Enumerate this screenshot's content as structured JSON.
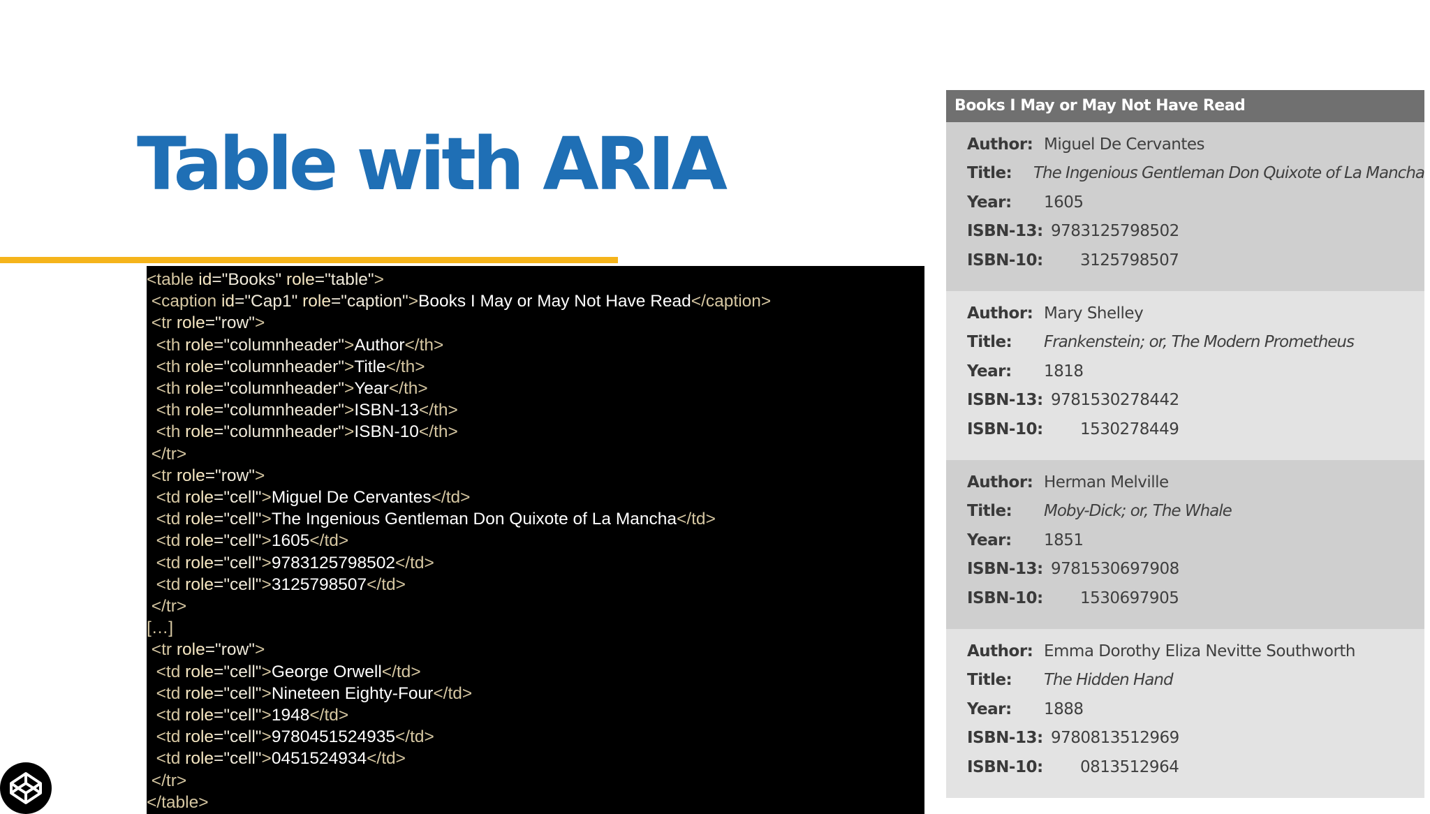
{
  "slide": {
    "title": "Table with ARIA"
  },
  "code": {
    "lines": [
      [
        [
          "tag",
          "<table "
        ],
        [
          "attr",
          "id"
        ],
        [
          "val",
          "=\"Books\" "
        ],
        [
          "attr",
          "role"
        ],
        [
          "val",
          "=\"table\""
        ],
        [
          "tag",
          ">"
        ]
      ],
      [
        [
          "tag",
          " <caption "
        ],
        [
          "attr",
          "id"
        ],
        [
          "val",
          "=\"Cap1\" "
        ],
        [
          "attr",
          "role"
        ],
        [
          "val",
          "=\"caption\""
        ],
        [
          "tag",
          ">"
        ],
        [
          "txt",
          "Books I May or May Not Have Read"
        ],
        [
          "tag",
          "</caption>"
        ]
      ],
      [
        [
          "tag",
          " <tr "
        ],
        [
          "attr",
          "role"
        ],
        [
          "val",
          "=\"row\""
        ],
        [
          "tag",
          ">"
        ]
      ],
      [
        [
          "tag",
          "  <th "
        ],
        [
          "attr",
          "role"
        ],
        [
          "val",
          "=\"columnheader\""
        ],
        [
          "tag",
          ">"
        ],
        [
          "txt",
          "Author"
        ],
        [
          "tag",
          "</th>"
        ]
      ],
      [
        [
          "tag",
          "  <th "
        ],
        [
          "attr",
          "role"
        ],
        [
          "val",
          "=\"columnheader\""
        ],
        [
          "tag",
          ">"
        ],
        [
          "txt",
          "Title"
        ],
        [
          "tag",
          "</th>"
        ]
      ],
      [
        [
          "tag",
          "  <th "
        ],
        [
          "attr",
          "role"
        ],
        [
          "val",
          "=\"columnheader\""
        ],
        [
          "tag",
          ">"
        ],
        [
          "txt",
          "Year"
        ],
        [
          "tag",
          "</th>"
        ]
      ],
      [
        [
          "tag",
          "  <th "
        ],
        [
          "attr",
          "role"
        ],
        [
          "val",
          "=\"columnheader\""
        ],
        [
          "tag",
          ">"
        ],
        [
          "txt",
          "ISBN-13"
        ],
        [
          "tag",
          "</th>"
        ]
      ],
      [
        [
          "tag",
          "  <th "
        ],
        [
          "attr",
          "role"
        ],
        [
          "val",
          "=\"columnheader\""
        ],
        [
          "tag",
          ">"
        ],
        [
          "txt",
          "ISBN-10"
        ],
        [
          "tag",
          "</th>"
        ]
      ],
      [
        [
          "tag",
          " </tr>"
        ]
      ],
      [
        [
          "tag",
          " <tr "
        ],
        [
          "attr",
          "role"
        ],
        [
          "val",
          "=\"row\""
        ],
        [
          "tag",
          ">"
        ]
      ],
      [
        [
          "tag",
          "  <td "
        ],
        [
          "attr",
          "role"
        ],
        [
          "val",
          "=\"cell\""
        ],
        [
          "tag",
          ">"
        ],
        [
          "txt",
          "Miguel De Cervantes"
        ],
        [
          "tag",
          "</td>"
        ]
      ],
      [
        [
          "tag",
          "  <td "
        ],
        [
          "attr",
          "role"
        ],
        [
          "val",
          "=\"cell\""
        ],
        [
          "tag",
          ">"
        ],
        [
          "txt",
          "The Ingenious Gentleman Don Quixote of La Mancha"
        ],
        [
          "tag",
          "</td>"
        ]
      ],
      [
        [
          "tag",
          "  <td "
        ],
        [
          "attr",
          "role"
        ],
        [
          "val",
          "=\"cell\""
        ],
        [
          "tag",
          ">"
        ],
        [
          "txt",
          "1605"
        ],
        [
          "tag",
          "</td>"
        ]
      ],
      [
        [
          "tag",
          "  <td "
        ],
        [
          "attr",
          "role"
        ],
        [
          "val",
          "=\"cell\""
        ],
        [
          "tag",
          ">"
        ],
        [
          "txt",
          "9783125798502"
        ],
        [
          "tag",
          "</td>"
        ]
      ],
      [
        [
          "tag",
          "  <td "
        ],
        [
          "attr",
          "role"
        ],
        [
          "val",
          "=\"cell\""
        ],
        [
          "tag",
          ">"
        ],
        [
          "txt",
          "3125798507"
        ],
        [
          "tag",
          "</td>"
        ]
      ],
      [
        [
          "tag",
          " </tr>"
        ]
      ],
      [
        [
          "tag",
          "[…]"
        ]
      ],
      [
        [
          "tag",
          " <tr "
        ],
        [
          "attr",
          "role"
        ],
        [
          "val",
          "=\"row\""
        ],
        [
          "tag",
          ">"
        ]
      ],
      [
        [
          "tag",
          "  <td "
        ],
        [
          "attr",
          "role"
        ],
        [
          "val",
          "=\"cell\""
        ],
        [
          "tag",
          ">"
        ],
        [
          "txt",
          "George Orwell"
        ],
        [
          "tag",
          "</td>"
        ]
      ],
      [
        [
          "tag",
          "  <td "
        ],
        [
          "attr",
          "role"
        ],
        [
          "val",
          "=\"cell\""
        ],
        [
          "tag",
          ">"
        ],
        [
          "txt",
          "Nineteen Eighty-Four"
        ],
        [
          "tag",
          "</td>"
        ]
      ],
      [
        [
          "tag",
          "  <td "
        ],
        [
          "attr",
          "role"
        ],
        [
          "val",
          "=\"cell\""
        ],
        [
          "tag",
          ">"
        ],
        [
          "txt",
          "1948"
        ],
        [
          "tag",
          "</td>"
        ]
      ],
      [
        [
          "tag",
          "  <td "
        ],
        [
          "attr",
          "role"
        ],
        [
          "val",
          "=\"cell\""
        ],
        [
          "tag",
          ">"
        ],
        [
          "txt",
          "9780451524935"
        ],
        [
          "tag",
          "</td>"
        ]
      ],
      [
        [
          "tag",
          "  <td "
        ],
        [
          "attr",
          "role"
        ],
        [
          "val",
          "=\"cell\""
        ],
        [
          "tag",
          ">"
        ],
        [
          "txt",
          "0451524934"
        ],
        [
          "tag",
          "</td>"
        ]
      ],
      [
        [
          "tag",
          " </tr>"
        ]
      ],
      [
        [
          "tag",
          "</table>"
        ]
      ]
    ]
  },
  "rendered_table": {
    "caption": "Books I May or May Not Have Read",
    "labels": {
      "author": "Author:",
      "title": "Title:",
      "year": "Year:",
      "isbn13": "ISBN-13:",
      "isbn10": "ISBN-10:"
    },
    "books": [
      {
        "author": "Miguel De Cervantes",
        "title": "The Ingenious Gentleman Don Quixote of La Mancha",
        "year": "1605",
        "isbn13": "9783125798502",
        "isbn10": "3125798507",
        "shade": "dark"
      },
      {
        "author": "Mary Shelley",
        "title": "Frankenstein; or, The Modern Prometheus",
        "year": "1818",
        "isbn13": "9781530278442",
        "isbn10": "1530278449",
        "shade": "light"
      },
      {
        "author": "Herman Melville",
        "title": "Moby-Dick; or, The Whale",
        "year": "1851",
        "isbn13": "9781530697908",
        "isbn10": "1530697905",
        "shade": "dark"
      },
      {
        "author": "Emma Dorothy Eliza Nevitte Southworth",
        "title": "The Hidden Hand",
        "year": "1888",
        "isbn13": "9780813512969",
        "isbn10": "0813512964",
        "shade": "light"
      }
    ]
  },
  "logo": {
    "icon": "codepen-icon"
  }
}
